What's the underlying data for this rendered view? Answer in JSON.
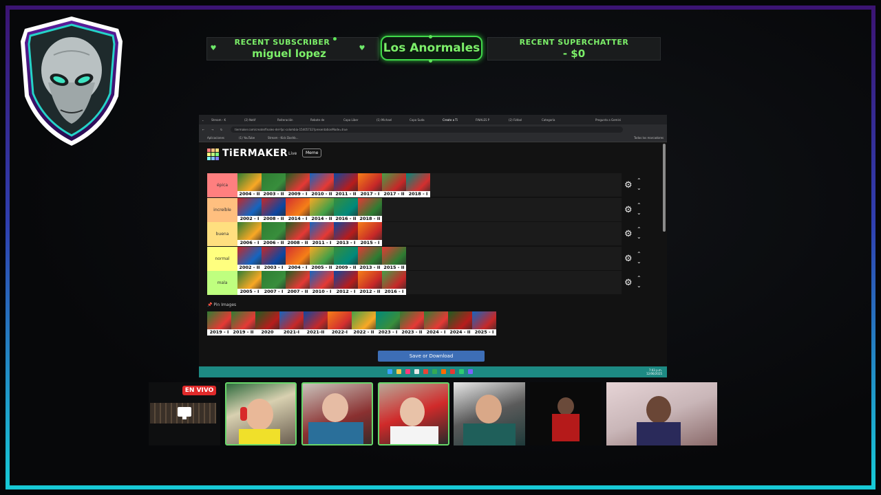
{
  "overlay": {
    "recent_subscriber_label": "RECENT SUBSCRIBER",
    "recent_subscriber_name": "miguel lopez",
    "channel_name": "Los Anormales",
    "recent_superchatter_label": "RECENT SUPERCHATTER",
    "recent_superchatter_value": "- $0",
    "live_badge": "EN VIVO",
    "accent_color": "#7cf069",
    "frame_colors": [
      "#3b1473",
      "#2f3fb0",
      "#17c9d6"
    ]
  },
  "browser": {
    "tabs": [
      "Stream - K",
      "(2) Notif",
      "Reiteración",
      "Rebote de",
      "Copa Liber",
      "(1) Michael",
      "Copa Suda",
      "Create a Ti",
      "FINALES P",
      "(2) Fútbol",
      "Categoría"
    ],
    "gemini_button": "Pregunta a Gemini",
    "address": "tiermaker.com/create/finales-del-fpc-colombia-15405732?presentationMode=true",
    "bookmarks": [
      "Aplicaciones",
      "(1) YouTube",
      "Stream - Kick Dashb..."
    ],
    "all_bookmarks": "Todos los marcadores"
  },
  "tiermaker": {
    "logo_text": "TiERMAKER",
    "live_link": "Live",
    "meme_button": "Meme",
    "tiers": [
      {
        "label": "épica",
        "color": "#ff7f7f",
        "items": [
          "2004 - II",
          "2003 - II",
          "2009 - I",
          "2010 - II",
          "2011 - II",
          "2017 - I",
          "2017 - II",
          "2018 - I"
        ]
      },
      {
        "label": "increíble",
        "color": "#ffbf7f",
        "items": [
          "2002 - I",
          "2008 - II",
          "2014 - I",
          "2014 - II",
          "2016 - II",
          "2018 - II"
        ]
      },
      {
        "label": "buena",
        "color": "#ffdf7f",
        "items": [
          "2006 - I",
          "2006 - II",
          "2008 - II",
          "2011 - I",
          "2013 - I",
          "2015 - I"
        ]
      },
      {
        "label": "normal",
        "color": "#ffff7f",
        "items": [
          "2002 - II",
          "2003 - I",
          "2004 - I",
          "2005 - II",
          "2009 - II",
          "2013 - II",
          "2015 - II"
        ]
      },
      {
        "label": "mala",
        "color": "#bfff7f",
        "items": [
          "2005 - I",
          "2007 - I",
          "2007 - II",
          "2010 - I",
          "2012 - I",
          "2012 - II",
          "2016 - I"
        ]
      }
    ],
    "pin_images_label": "Pin Images",
    "pool": [
      "2019 - I",
      "2019 - II",
      "2020",
      "2021-I",
      "2021-II",
      "2022-I",
      "2022 - II",
      "2023 - I",
      "2023 - II",
      "2024 - I",
      "2024 - II",
      "2025 - I"
    ],
    "save_button": "Save or Download"
  },
  "taskbar": {
    "time": "7:03 p.m.",
    "date": "12/06/2025"
  }
}
